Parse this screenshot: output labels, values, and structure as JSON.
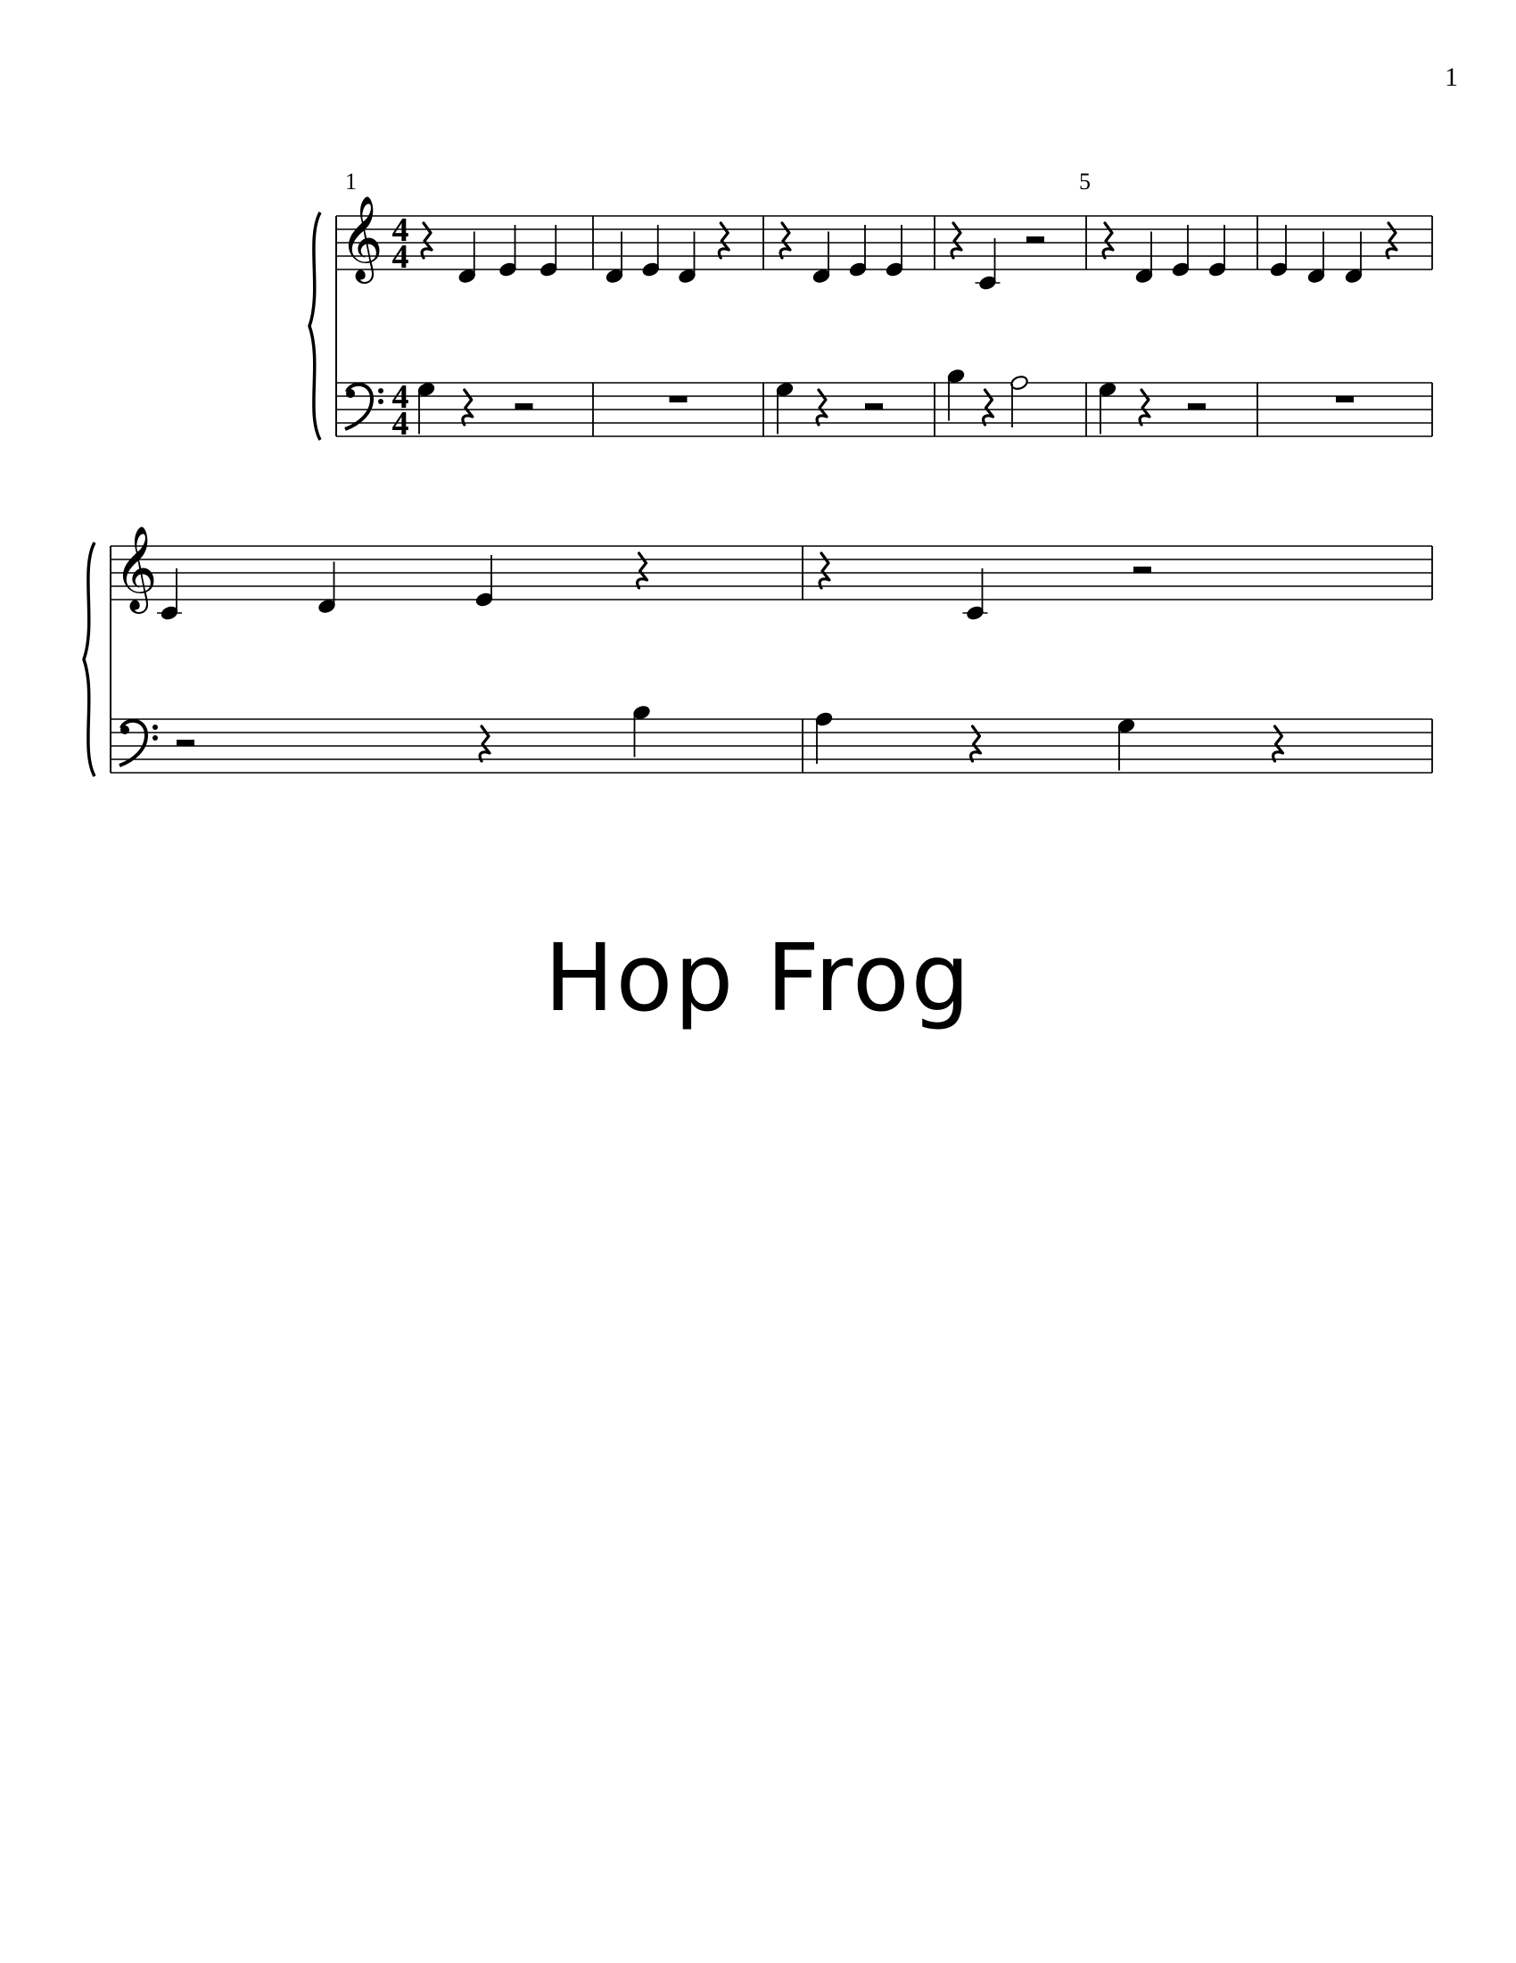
{
  "page_number": "1",
  "title": "Hop Frog",
  "time_signature": {
    "numerator": "4",
    "denominator": "4"
  },
  "instrument": "piano",
  "systems": [
    {
      "first_measure_number": 1,
      "printed_measure_numbers": [
        "1",
        "5"
      ],
      "treble": [
        [
          {
            "t": "rest",
            "d": "q"
          },
          {
            "t": "note",
            "p": "D4",
            "d": "q"
          },
          {
            "t": "note",
            "p": "E4",
            "d": "q"
          },
          {
            "t": "note",
            "p": "E4",
            "d": "q"
          }
        ],
        [
          {
            "t": "note",
            "p": "D4",
            "d": "q"
          },
          {
            "t": "note",
            "p": "E4",
            "d": "q"
          },
          {
            "t": "note",
            "p": "D4",
            "d": "q"
          },
          {
            "t": "rest",
            "d": "q"
          }
        ],
        [
          {
            "t": "rest",
            "d": "q"
          },
          {
            "t": "note",
            "p": "D4",
            "d": "q"
          },
          {
            "t": "note",
            "p": "E4",
            "d": "q"
          },
          {
            "t": "note",
            "p": "E4",
            "d": "q"
          }
        ],
        [
          {
            "t": "rest",
            "d": "q"
          },
          {
            "t": "note",
            "p": "C4",
            "d": "q"
          },
          {
            "t": "rest",
            "d": "h"
          }
        ],
        [
          {
            "t": "rest",
            "d": "q"
          },
          {
            "t": "note",
            "p": "D4",
            "d": "q"
          },
          {
            "t": "note",
            "p": "E4",
            "d": "q"
          },
          {
            "t": "note",
            "p": "E4",
            "d": "q"
          }
        ],
        [
          {
            "t": "note",
            "p": "E4",
            "d": "q"
          },
          {
            "t": "note",
            "p": "D4",
            "d": "q"
          },
          {
            "t": "note",
            "p": "D4",
            "d": "q"
          },
          {
            "t": "rest",
            "d": "q"
          }
        ]
      ],
      "bass": [
        [
          {
            "t": "note",
            "p": "G3",
            "d": "q"
          },
          {
            "t": "rest",
            "d": "q"
          },
          {
            "t": "rest",
            "d": "h"
          }
        ],
        [
          {
            "t": "rest",
            "d": "w"
          }
        ],
        [
          {
            "t": "note",
            "p": "G3",
            "d": "q"
          },
          {
            "t": "rest",
            "d": "q"
          },
          {
            "t": "rest",
            "d": "h"
          }
        ],
        [
          {
            "t": "note",
            "p": "B3",
            "d": "q"
          },
          {
            "t": "rest",
            "d": "q"
          },
          {
            "t": "note",
            "p": "A3",
            "d": "h"
          }
        ],
        [
          {
            "t": "note",
            "p": "G3",
            "d": "q"
          },
          {
            "t": "rest",
            "d": "q"
          },
          {
            "t": "rest",
            "d": "h"
          }
        ],
        [
          {
            "t": "rest",
            "d": "w"
          }
        ]
      ]
    },
    {
      "first_measure_number": 7,
      "printed_measure_numbers": [],
      "treble": [
        [
          {
            "t": "note",
            "p": "C4",
            "d": "q"
          },
          {
            "t": "note",
            "p": "D4",
            "d": "q"
          },
          {
            "t": "note",
            "p": "E4",
            "d": "q"
          },
          {
            "t": "rest",
            "d": "q"
          }
        ],
        [
          {
            "t": "rest",
            "d": "q"
          },
          {
            "t": "note",
            "p": "C4",
            "d": "q"
          },
          {
            "t": "rest",
            "d": "h"
          }
        ]
      ],
      "bass": [
        [
          {
            "t": "rest",
            "d": "h"
          },
          {
            "t": "rest",
            "d": "q"
          },
          {
            "t": "note",
            "p": "B3",
            "d": "q"
          }
        ],
        [
          {
            "t": "note",
            "p": "A3",
            "d": "q"
          },
          {
            "t": "rest",
            "d": "q"
          },
          {
            "t": "note",
            "p": "G3",
            "d": "q"
          },
          {
            "t": "rest",
            "d": "q"
          }
        ]
      ]
    }
  ]
}
